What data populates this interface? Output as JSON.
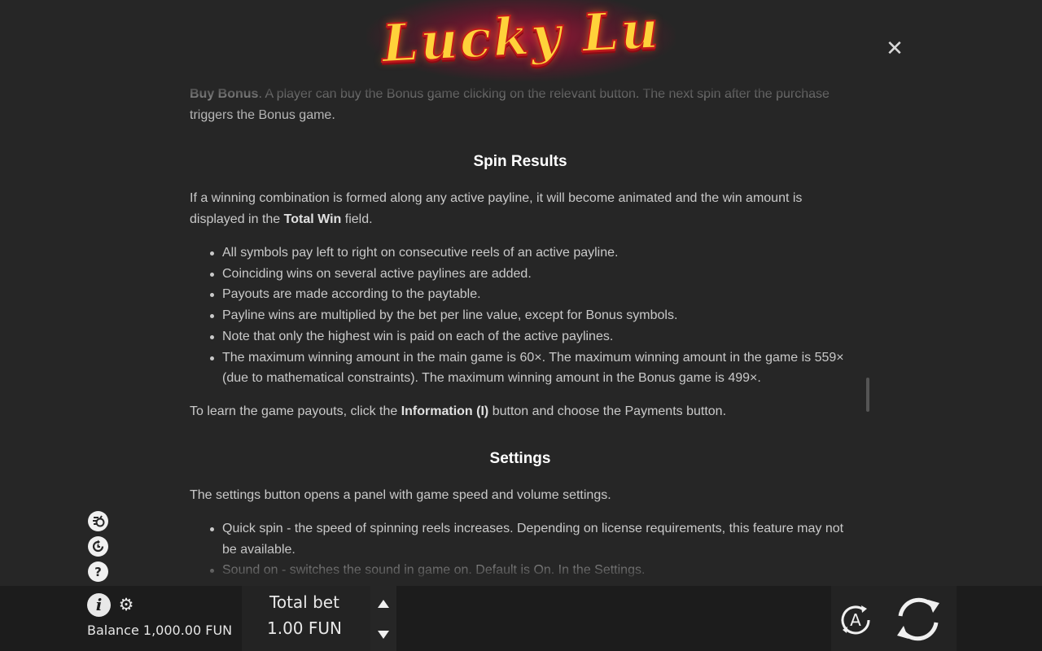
{
  "header": {
    "logo_text": "Lucky Lu",
    "close_icon": "close-icon"
  },
  "content": {
    "intro": {
      "bold": "Buy Bonus",
      "text": ". A player can buy the Bonus game clicking on the relevant button. The next spin after the purchase triggers the Bonus game."
    },
    "spin_results": {
      "heading": "Spin Results",
      "p1_before": "If a winning combination is formed along any active payline, it will become animated and the win amount is displayed in the ",
      "p1_bold": "Total Win",
      "p1_after": " field.",
      "bullets": [
        "All symbols pay left to right on consecutive reels of an active payline.",
        "Coinciding wins on several active paylines are added.",
        "Payouts are made according to the paytable.",
        "Payline wins are multiplied by the bet per line value, except for Bonus symbols.",
        "Note that only the highest win is paid on each of the active paylines.",
        "The maximum winning amount in the main game is 60×. The maximum winning amount in the game is 559× (due to mathematical constraints). The maximum winning amount in the Bonus game is 499×."
      ],
      "p2_before": "To learn the game payouts, click the ",
      "p2_bold": "Information (I)",
      "p2_after": " button and choose the Payments button."
    },
    "settings": {
      "heading": "Settings",
      "p1": "The settings button opens a panel with game speed and volume settings.",
      "bullets": [
        "Quick spin - the speed of spinning reels increases. Depending on license requirements, this feature may not be available.",
        "Sound on - switches the sound in game on. Default is On. In the Settings."
      ]
    }
  },
  "side_icons": [
    "buy-bonus-icon",
    "history-icon",
    "help-icon"
  ],
  "bottom": {
    "balance": "Balance 1,000.00 FUN",
    "total_bet_label": "Total bet",
    "total_bet_value": "1.00 FUN",
    "auto_label": "A"
  }
}
